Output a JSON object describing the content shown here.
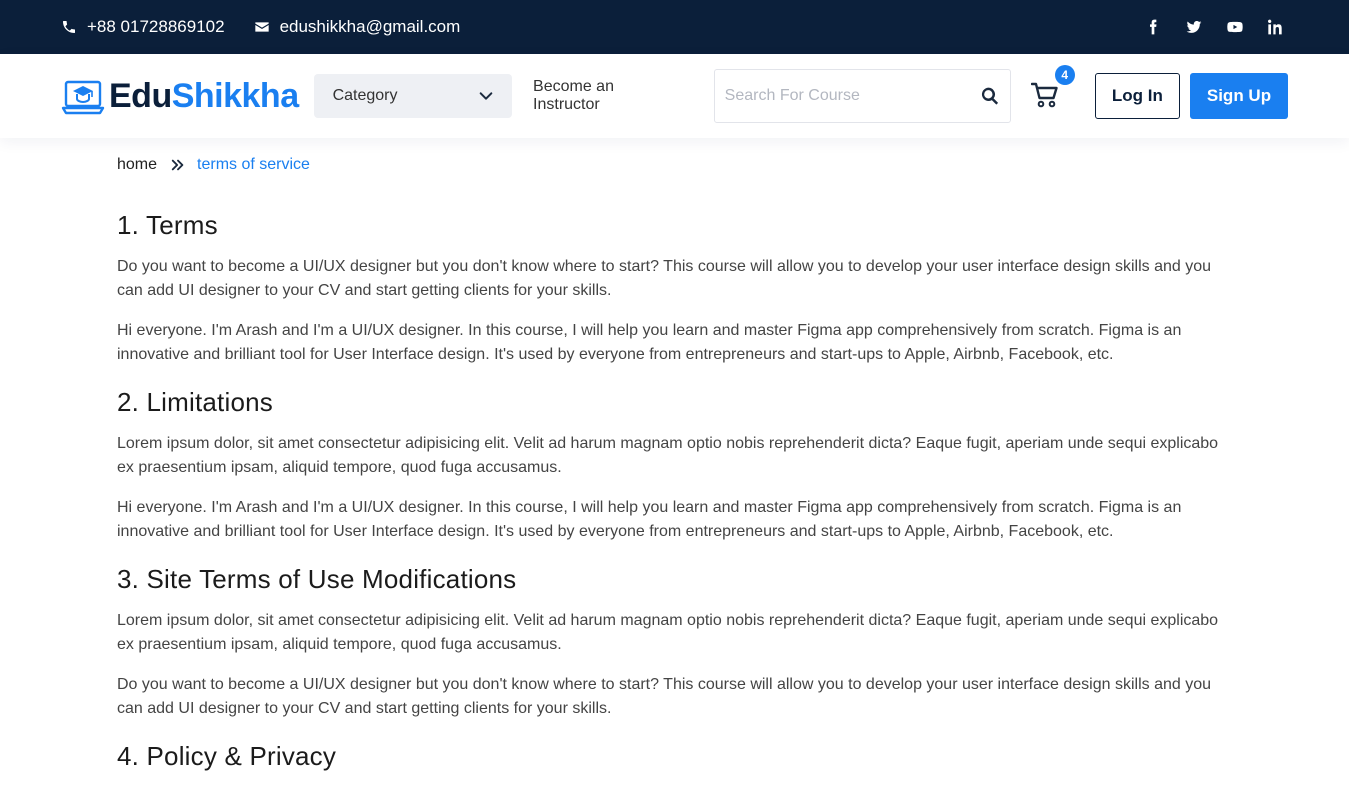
{
  "topbar": {
    "phone": "+88 01728869102",
    "email": "edushikkha@gmail.com",
    "socials": [
      "facebook-icon",
      "twitter-icon",
      "youtube-icon",
      "linkedin-icon"
    ]
  },
  "header": {
    "logo_edu": "Edu",
    "logo_shikkha": "Shikkha",
    "category_label": "Category",
    "become_instructor": "Become an Instructor",
    "search_placeholder": "Search For Course",
    "cart_count": "4",
    "login_label": "Log In",
    "signup_label": "Sign Up"
  },
  "breadcrumb": {
    "home": "home",
    "current": "terms of service"
  },
  "sections": [
    {
      "title": "1. Terms",
      "paragraphs": [
        "Do you want to become a UI/UX designer but you don't know where to start? This course will allow you to develop your user interface design skills and you can add UI designer to your CV and start getting clients for your skills.",
        "Hi everyone. I'm Arash and I'm a UI/UX designer. In this course, I will help you learn and master Figma app comprehensively from scratch. Figma is an innovative and brilliant tool for User Interface design. It's used by everyone from entrepreneurs and start-ups to Apple, Airbnb, Facebook, etc."
      ]
    },
    {
      "title": "2. Limitations",
      "paragraphs": [
        "Lorem ipsum dolor, sit amet consectetur adipisicing elit. Velit ad harum magnam optio nobis reprehenderit dicta? Eaque fugit, aperiam unde sequi explicabo ex praesentium ipsam, aliquid tempore, quod fuga accusamus.",
        "Hi everyone. I'm Arash and I'm a UI/UX designer. In this course, I will help you learn and master Figma app comprehensively from scratch. Figma is an innovative and brilliant tool for User Interface design. It's used by everyone from entrepreneurs and start-ups to Apple, Airbnb, Facebook, etc."
      ]
    },
    {
      "title": "3. Site Terms of Use Modifications",
      "paragraphs": [
        "Lorem ipsum dolor, sit amet consectetur adipisicing elit. Velit ad harum magnam optio nobis reprehenderit dicta? Eaque fugit, aperiam unde sequi explicabo ex praesentium ipsam, aliquid tempore, quod fuga accusamus.",
        "Do you want to become a UI/UX designer but you don't know where to start? This course will allow you to develop your user interface design skills and you can add UI designer to your CV and start getting clients for your skills."
      ]
    },
    {
      "title": "4. Policy & Privacy",
      "paragraphs": []
    }
  ],
  "colors": {
    "topbar_bg": "#0b1f3a",
    "accent": "#1a7ff0"
  }
}
